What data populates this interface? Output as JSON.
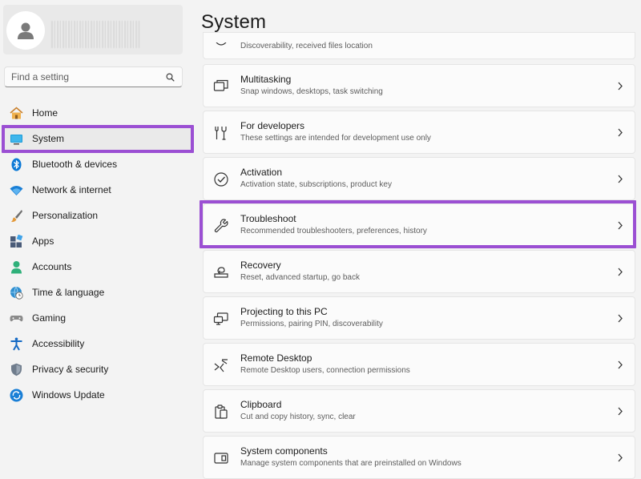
{
  "window": {
    "page_title": "System"
  },
  "sidebar": {
    "search": {
      "placeholder": "Find a setting"
    },
    "items": [
      {
        "label": "Home",
        "icon": "home-icon",
        "color": "#e8a23a"
      },
      {
        "label": "System",
        "icon": "system-icon",
        "color": "#1a9bd8",
        "active": true
      },
      {
        "label": "Bluetooth & devices",
        "icon": "bluetooth-icon",
        "color": "#0a78d6"
      },
      {
        "label": "Network & internet",
        "icon": "wifi-icon",
        "color": "#1a7fd6"
      },
      {
        "label": "Personalization",
        "icon": "brush-icon",
        "color": "#d98a3a"
      },
      {
        "label": "Apps",
        "icon": "apps-icon",
        "color": "#4a5b78"
      },
      {
        "label": "Accounts",
        "icon": "account-icon",
        "color": "#2fb07a"
      },
      {
        "label": "Time & language",
        "icon": "globe-clock-icon",
        "color": "#2f8fd0"
      },
      {
        "label": "Gaming",
        "icon": "gamepad-icon",
        "color": "#7a7a7a"
      },
      {
        "label": "Accessibility",
        "icon": "accessibility-icon",
        "color": "#1469c4"
      },
      {
        "label": "Privacy & security",
        "icon": "shield-icon",
        "color": "#6f7c8c"
      },
      {
        "label": "Windows Update",
        "icon": "update-icon",
        "color": "#1a7fd6"
      }
    ]
  },
  "main": {
    "cards": [
      {
        "title": "",
        "subtitle": "Discoverability, received files location",
        "icon": "nearby-sharing-icon"
      },
      {
        "title": "Multitasking",
        "subtitle": "Snap windows, desktops, task switching",
        "icon": "multitasking-icon"
      },
      {
        "title": "For developers",
        "subtitle": "These settings are intended for development use only",
        "icon": "developer-icon"
      },
      {
        "title": "Activation",
        "subtitle": "Activation state, subscriptions, product key",
        "icon": "activation-check-icon"
      },
      {
        "title": "Troubleshoot",
        "subtitle": "Recommended troubleshooters, preferences, history",
        "icon": "wrench-icon"
      },
      {
        "title": "Recovery",
        "subtitle": "Reset, advanced startup, go back",
        "icon": "recovery-icon"
      },
      {
        "title": "Projecting to this PC",
        "subtitle": "Permissions, pairing PIN, discoverability",
        "icon": "projecting-icon"
      },
      {
        "title": "Remote Desktop",
        "subtitle": "Remote Desktop users, connection permissions",
        "icon": "remote-desktop-icon"
      },
      {
        "title": "Clipboard",
        "subtitle": "Cut and copy history, sync, clear",
        "icon": "clipboard-icon"
      },
      {
        "title": "System components",
        "subtitle": "Manage system components that are preinstalled on Windows",
        "icon": "system-components-icon"
      }
    ]
  },
  "colors": {
    "highlight": "#9b4fd3",
    "background": "#f3f3f3",
    "card": "#fbfbfb"
  }
}
